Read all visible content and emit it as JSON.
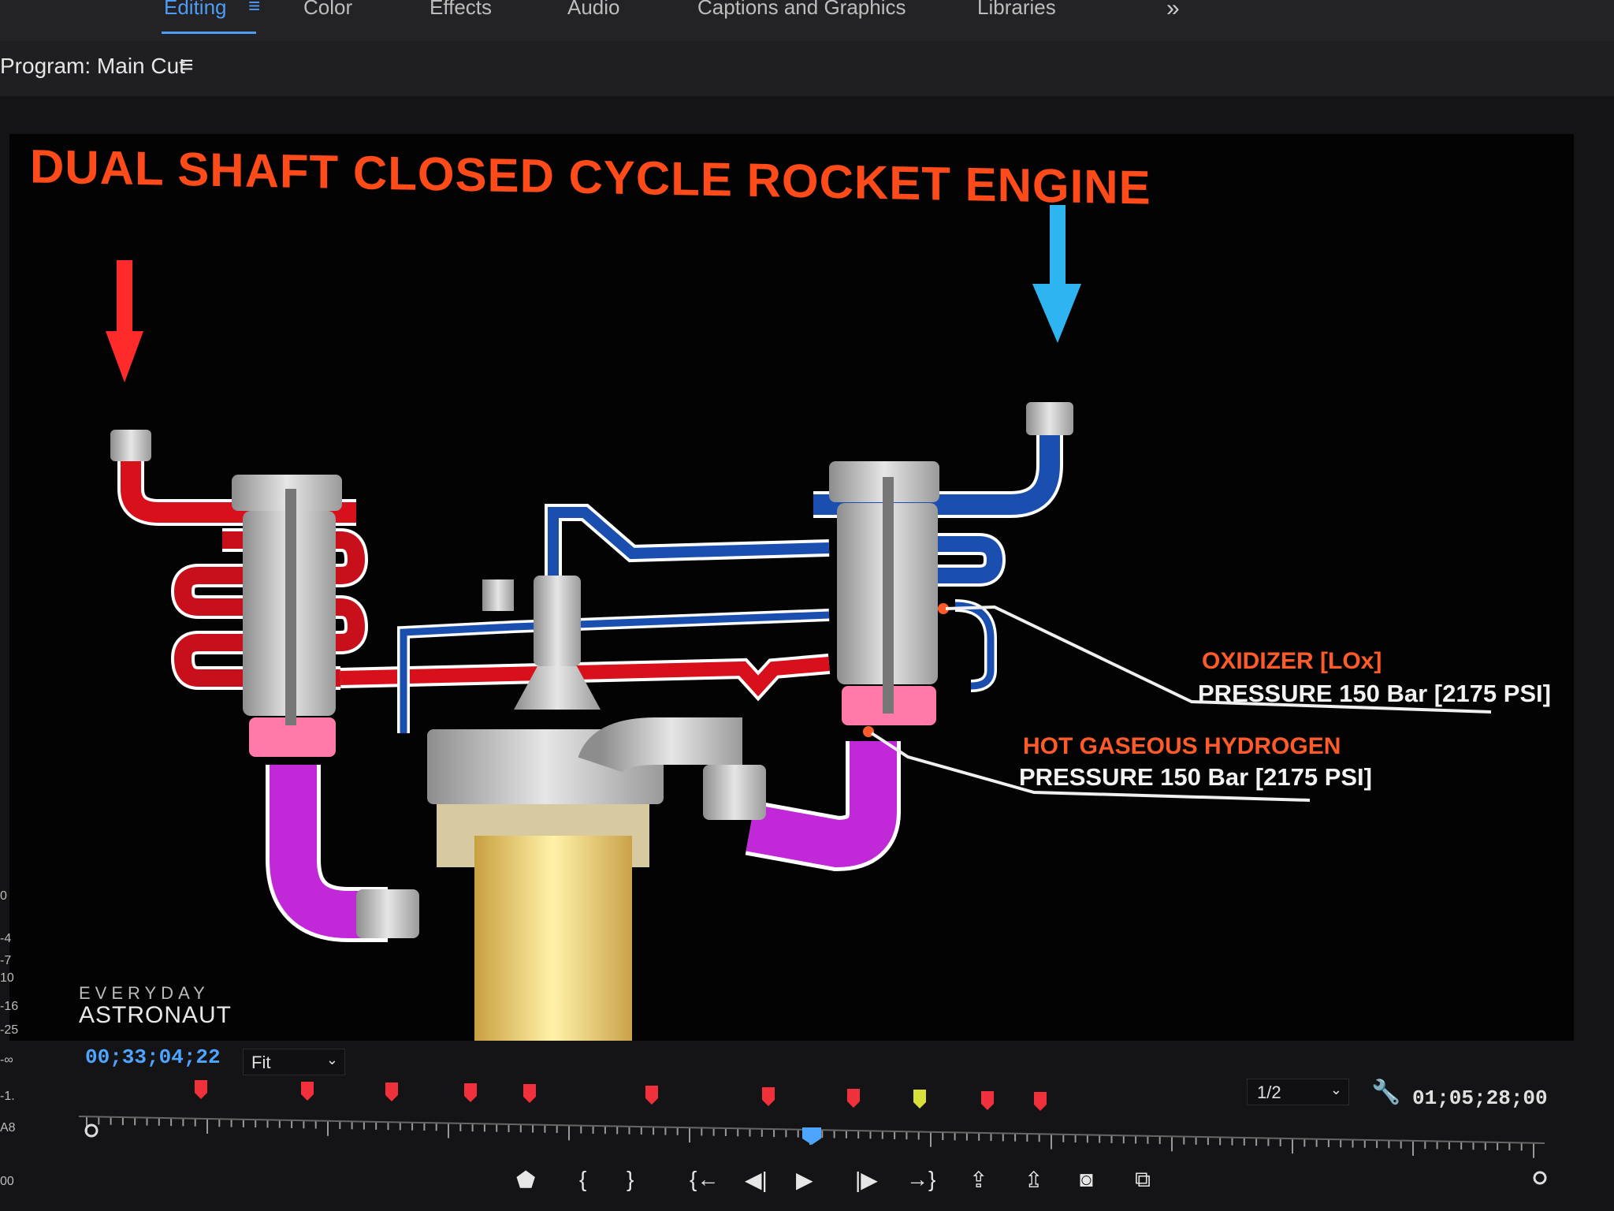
{
  "workspace": {
    "tabs": [
      {
        "label": "Editing",
        "active": true
      },
      {
        "label": "Color",
        "active": false
      },
      {
        "label": "Effects",
        "active": false
      },
      {
        "label": "Audio",
        "active": false
      },
      {
        "label": "Captions and Graphics",
        "active": false
      },
      {
        "label": "Libraries",
        "active": false
      }
    ],
    "more_icon": "double-chevron-right-icon"
  },
  "program_monitor": {
    "title": "Program: Main Cut",
    "menu_icon": "hamburger-menu-icon"
  },
  "video": {
    "title": "DUAL SHAFT CLOSED CYCLE ROCKET ENGINE",
    "oxidizer_label": "OXIDIZER [LOx]",
    "oxidizer_pressure": "PRESSURE 150 Bar [2175 PSI]",
    "hydrogen_label": "HOT GASEOUS HYDROGEN",
    "hydrogen_pressure": "PRESSURE 150 Bar [2175 PSI]",
    "watermark_line1": "EVERYDAY",
    "watermark_line2": "ASTRONAUT",
    "colors": {
      "title": "#ff4a1a",
      "fuel_pipe": "#e0121e",
      "oxidizer_pipe": "#1a4fb0",
      "hot_gas_pipe": "#c028d8",
      "arrow_red": "#ff2a2a",
      "arrow_blue": "#2fb4f2"
    }
  },
  "controls": {
    "current_timecode": "00;33;04;22",
    "zoom_value": "Fit",
    "resolution_value": "1/2",
    "duration_timecode": "01;05;28;00",
    "settings_icon": "wrench-icon"
  },
  "markers": [
    "red",
    "red",
    "red",
    "red",
    "red",
    "red",
    "red",
    "red",
    "yellow",
    "red",
    "red"
  ],
  "meter_labels": [
    "0",
    "-4",
    "-7",
    "10",
    "-16",
    "-25",
    "-∞",
    "-1.",
    "A8",
    "00"
  ],
  "transport": [
    {
      "name": "add-marker-button",
      "glyph": "⬟"
    },
    {
      "name": "mark-in-button",
      "glyph": "{"
    },
    {
      "name": "mark-out-button",
      "glyph": "}"
    },
    {
      "name": "go-to-in-button",
      "glyph": "{←"
    },
    {
      "name": "step-back-button",
      "glyph": "◀|"
    },
    {
      "name": "play-button",
      "glyph": "▶"
    },
    {
      "name": "step-forward-button",
      "glyph": "|▶"
    },
    {
      "name": "go-to-out-button",
      "glyph": "→}"
    },
    {
      "name": "lift-button",
      "glyph": "⇪"
    },
    {
      "name": "extract-button",
      "glyph": "⇫"
    },
    {
      "name": "export-frame-button",
      "glyph": "◙"
    },
    {
      "name": "comparison-view-button",
      "glyph": "⧉"
    }
  ]
}
